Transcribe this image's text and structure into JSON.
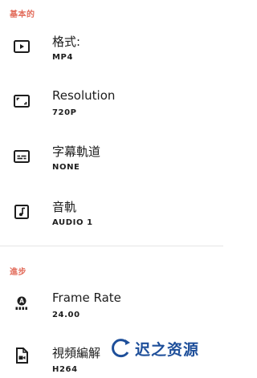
{
  "sections": {
    "basic": {
      "header": "基本的"
    },
    "advanced": {
      "header": "進步"
    }
  },
  "rows": {
    "format": {
      "title": "格式:",
      "value": "MP4",
      "icon": "play-box-icon"
    },
    "resolution": {
      "title": "Resolution",
      "value": "720P",
      "icon": "aspect-ratio-icon"
    },
    "subtitle": {
      "title": "字幕軌道",
      "value": "NONE",
      "icon": "subtitles-icon"
    },
    "audio": {
      "title": "音軌",
      "value": "AUDIO 1",
      "icon": "music-note-box-icon"
    },
    "framerate": {
      "title": "Frame Rate",
      "value": "24.00",
      "icon": "auto-framerate-icon"
    },
    "codec": {
      "title": "視頻編解",
      "value": "H264",
      "icon": "video-file-icon"
    }
  },
  "watermark": {
    "text": "迟之资源",
    "icon": "watermark-logo-icon"
  },
  "colors": {
    "section_header": "#e26b5a",
    "text": "#1d1d1d",
    "divider": "#e6e6e6",
    "watermark": "#1e4f9a"
  }
}
